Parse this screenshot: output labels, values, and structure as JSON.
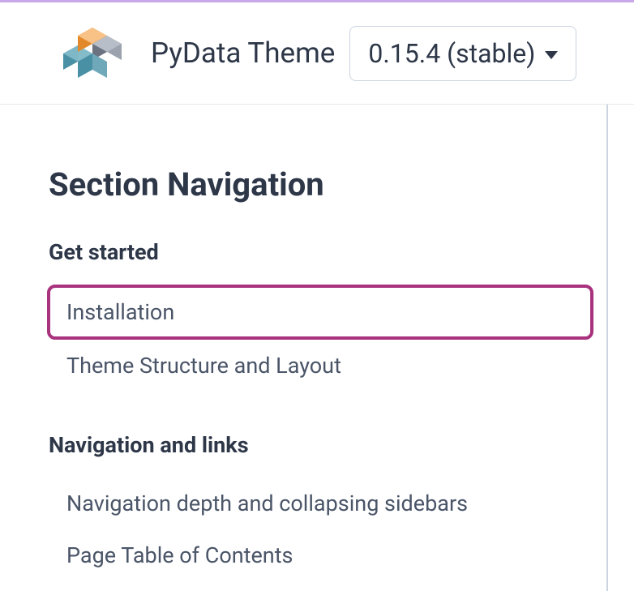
{
  "header": {
    "brand_title": "PyData Theme",
    "version_label": "0.15.4 (stable)"
  },
  "sidebar": {
    "heading": "Section Navigation",
    "groups": [
      {
        "title": "Get started",
        "items": [
          {
            "label": "Installation",
            "highlighted": true
          },
          {
            "label": "Theme Structure and Layout",
            "highlighted": false
          }
        ]
      },
      {
        "title": "Navigation and links",
        "items": [
          {
            "label": "Navigation depth and collapsing sidebars",
            "highlighted": false
          },
          {
            "label": "Page Table of Contents",
            "highlighted": false
          }
        ]
      }
    ]
  }
}
